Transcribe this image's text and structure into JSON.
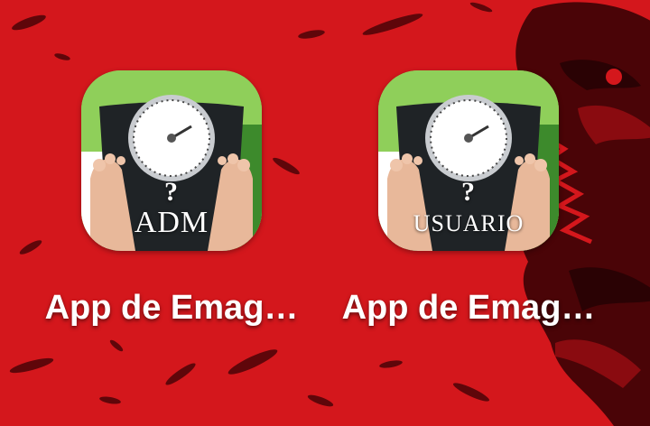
{
  "home_screen": {
    "apps": [
      {
        "name": "App de Emag…",
        "icon_text": "ADM",
        "icon_mark": "?"
      },
      {
        "name": "App de Emag…",
        "icon_text": "USUARIO",
        "icon_mark": "?"
      }
    ]
  },
  "colors": {
    "wallpaper": "#d4171c",
    "wallpaper_accent": "#4a0407",
    "icon_background": "#8fcf5a"
  },
  "icons": {
    "app_icon": "bathroom-scale-feet-icon"
  }
}
